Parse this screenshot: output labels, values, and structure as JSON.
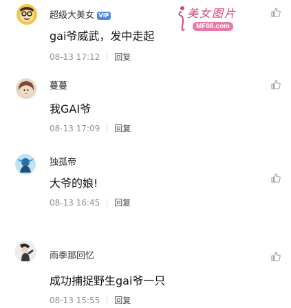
{
  "watermark": {
    "brand": "美女图片",
    "url": "MF08.com"
  },
  "comments": [
    {
      "username": "超级大美女",
      "vip_label": "VIP",
      "text": "gai爷威武，发中走起",
      "date": "08-13",
      "time": "17:12",
      "reply_label": "回复"
    },
    {
      "username": "蔓蔓",
      "text": "我GAI爷",
      "date": "08-13",
      "time": "17:09",
      "reply_label": "回复"
    },
    {
      "username": "独孤帝",
      "text": "大爷的娘!",
      "date": "08-13",
      "time": "16:45",
      "reply_label": "回复"
    },
    {
      "username": "雨季那回忆",
      "text": "成功捕捉野生gai爷一只",
      "date": "08-13",
      "time": "15:55",
      "reply_label": "回复"
    }
  ],
  "colors": {
    "vip_badge": "#4f8be6",
    "watermark": "#d14a79",
    "meta_text": "#8f8f8f"
  }
}
